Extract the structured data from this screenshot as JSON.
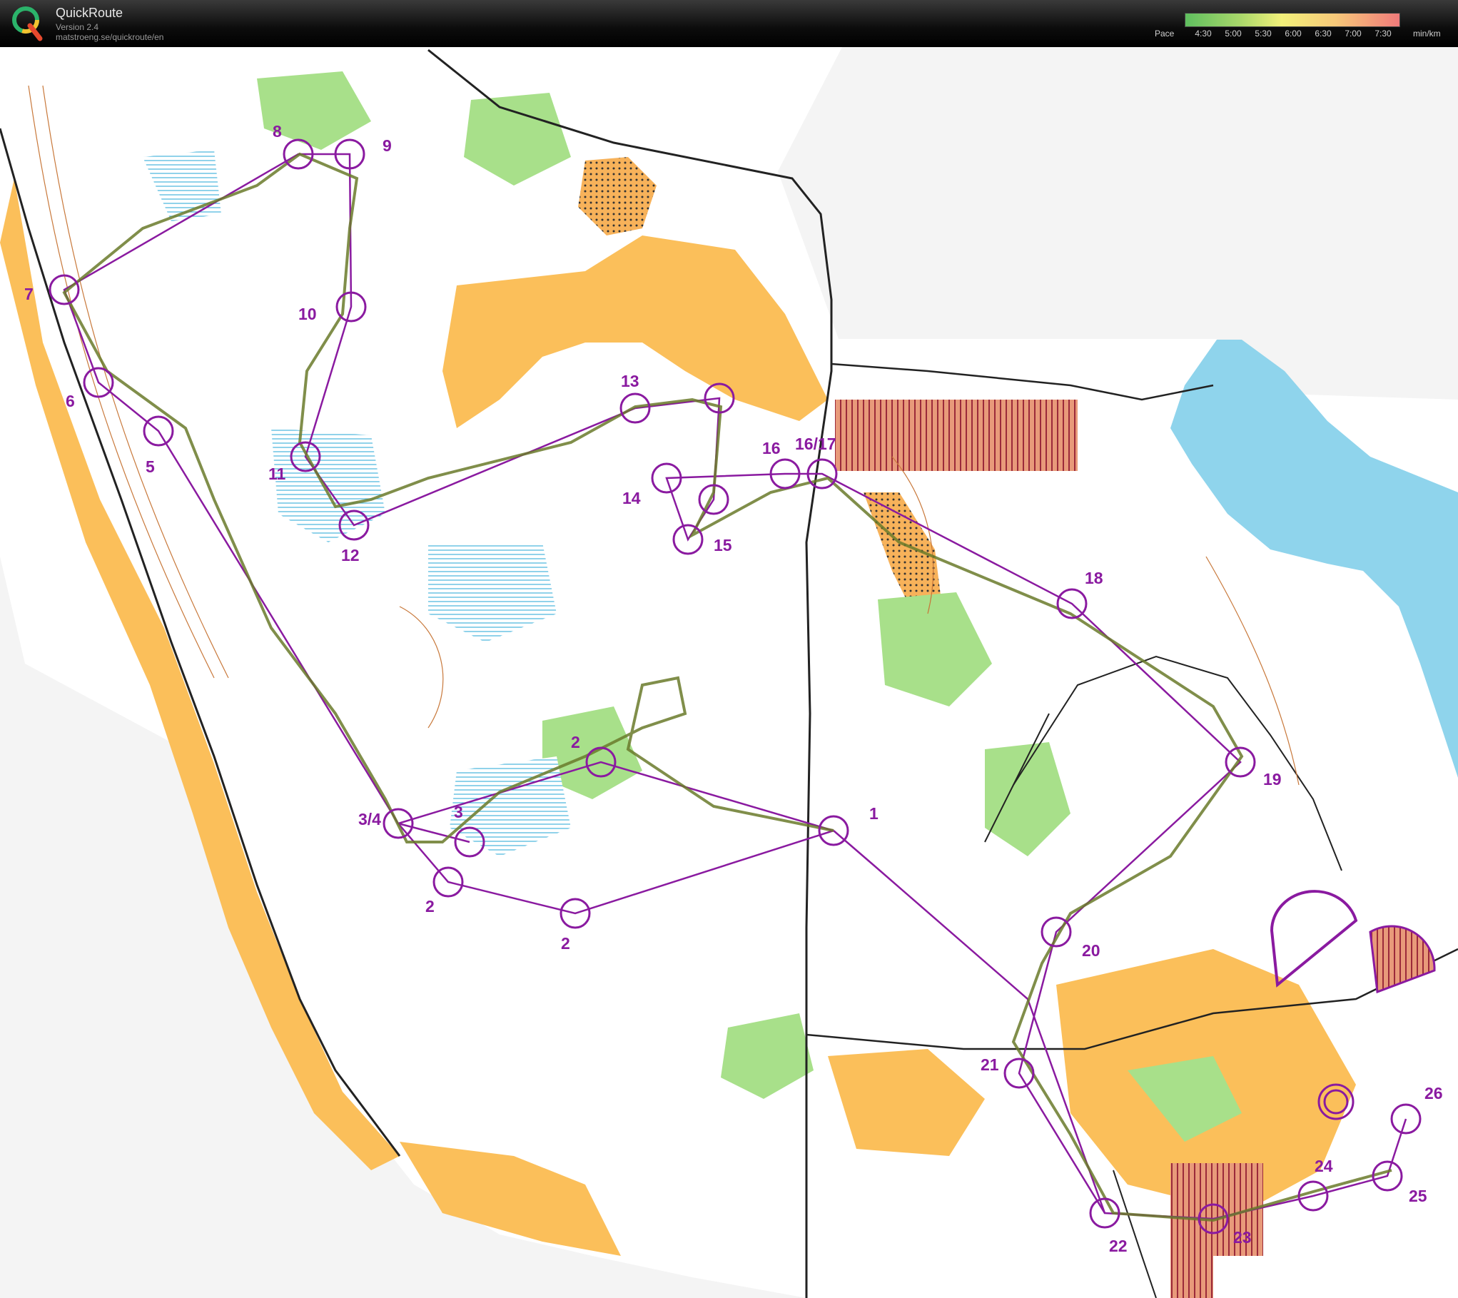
{
  "app": {
    "title": "QuickRoute",
    "version": "Version 2.4",
    "url": "matstroeng.se/quickroute/en"
  },
  "pace_legend": {
    "label": "Pace",
    "ticks": [
      "4:30",
      "5:00",
      "5:30",
      "6:00",
      "6:30",
      "7:00",
      "7:30"
    ],
    "unit": "min/km"
  },
  "colors": {
    "course": "#8a1aa0",
    "route": "#6a7a2a",
    "water": "#8fd4ec",
    "open": "#fbbf5a",
    "forest_green": "#a8e08a"
  },
  "controls": [
    {
      "label": "1"
    },
    {
      "label": "2"
    },
    {
      "label": "2"
    },
    {
      "label": "2"
    },
    {
      "label": "3"
    },
    {
      "label": "3/4"
    },
    {
      "label": "5"
    },
    {
      "label": "6"
    },
    {
      "label": "7"
    },
    {
      "label": "8"
    },
    {
      "label": "9"
    },
    {
      "label": "10"
    },
    {
      "label": "11"
    },
    {
      "label": "12"
    },
    {
      "label": "13"
    },
    {
      "label": "14"
    },
    {
      "label": "15"
    },
    {
      "label": "16"
    },
    {
      "label": "16/17"
    },
    {
      "label": "18"
    },
    {
      "label": "19"
    },
    {
      "label": "20"
    },
    {
      "label": "21"
    },
    {
      "label": "22"
    },
    {
      "label": "23"
    },
    {
      "label": "24"
    },
    {
      "label": "25"
    },
    {
      "label": "26"
    }
  ]
}
